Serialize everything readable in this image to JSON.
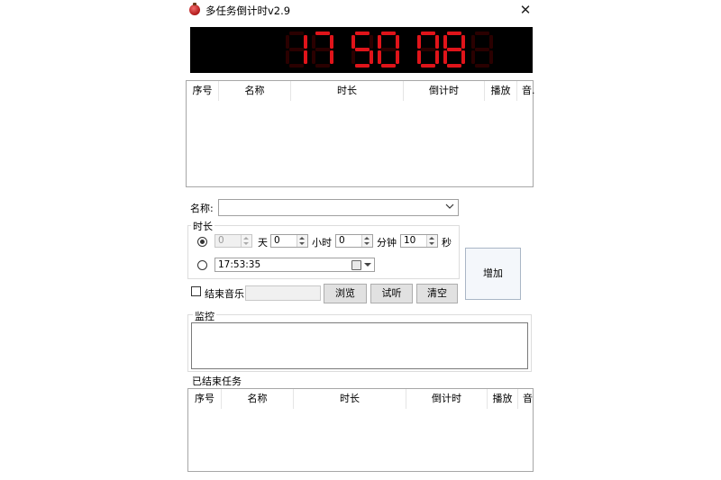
{
  "window": {
    "title": "多任务倒计时v2.9",
    "close_glyph": "✕"
  },
  "display": {
    "time": "17:50:08",
    "led_color": "#e0141a",
    "led_dim_color": "#2a0000",
    "background": "#000000"
  },
  "task_table": {
    "columns": [
      "序号",
      "名称",
      "时长",
      "倒计时",
      "播放",
      "音."
    ]
  },
  "form": {
    "name_label": "名称:",
    "name_value": "",
    "duration_group_label": "时长",
    "days_value": "0",
    "days_unit": "天",
    "hours_value": "0",
    "hours_unit": "小时",
    "minutes_value": "0",
    "minutes_unit": "分钟",
    "seconds_value": "10",
    "seconds_unit": "秒",
    "duration_mode_selected": true,
    "clock_mode_selected": false,
    "clock_time": "17:53:35",
    "end_music_label": "结束音乐",
    "end_music_checked": false,
    "browse_label": "浏览",
    "listen_label": "试听",
    "clear_label": "清空",
    "add_label": "增加"
  },
  "monitor": {
    "label": "监控"
  },
  "finished": {
    "label": "已结束任务",
    "columns": [
      "序号",
      "名称",
      "时长",
      "倒计时",
      "播放",
      "音"
    ]
  }
}
